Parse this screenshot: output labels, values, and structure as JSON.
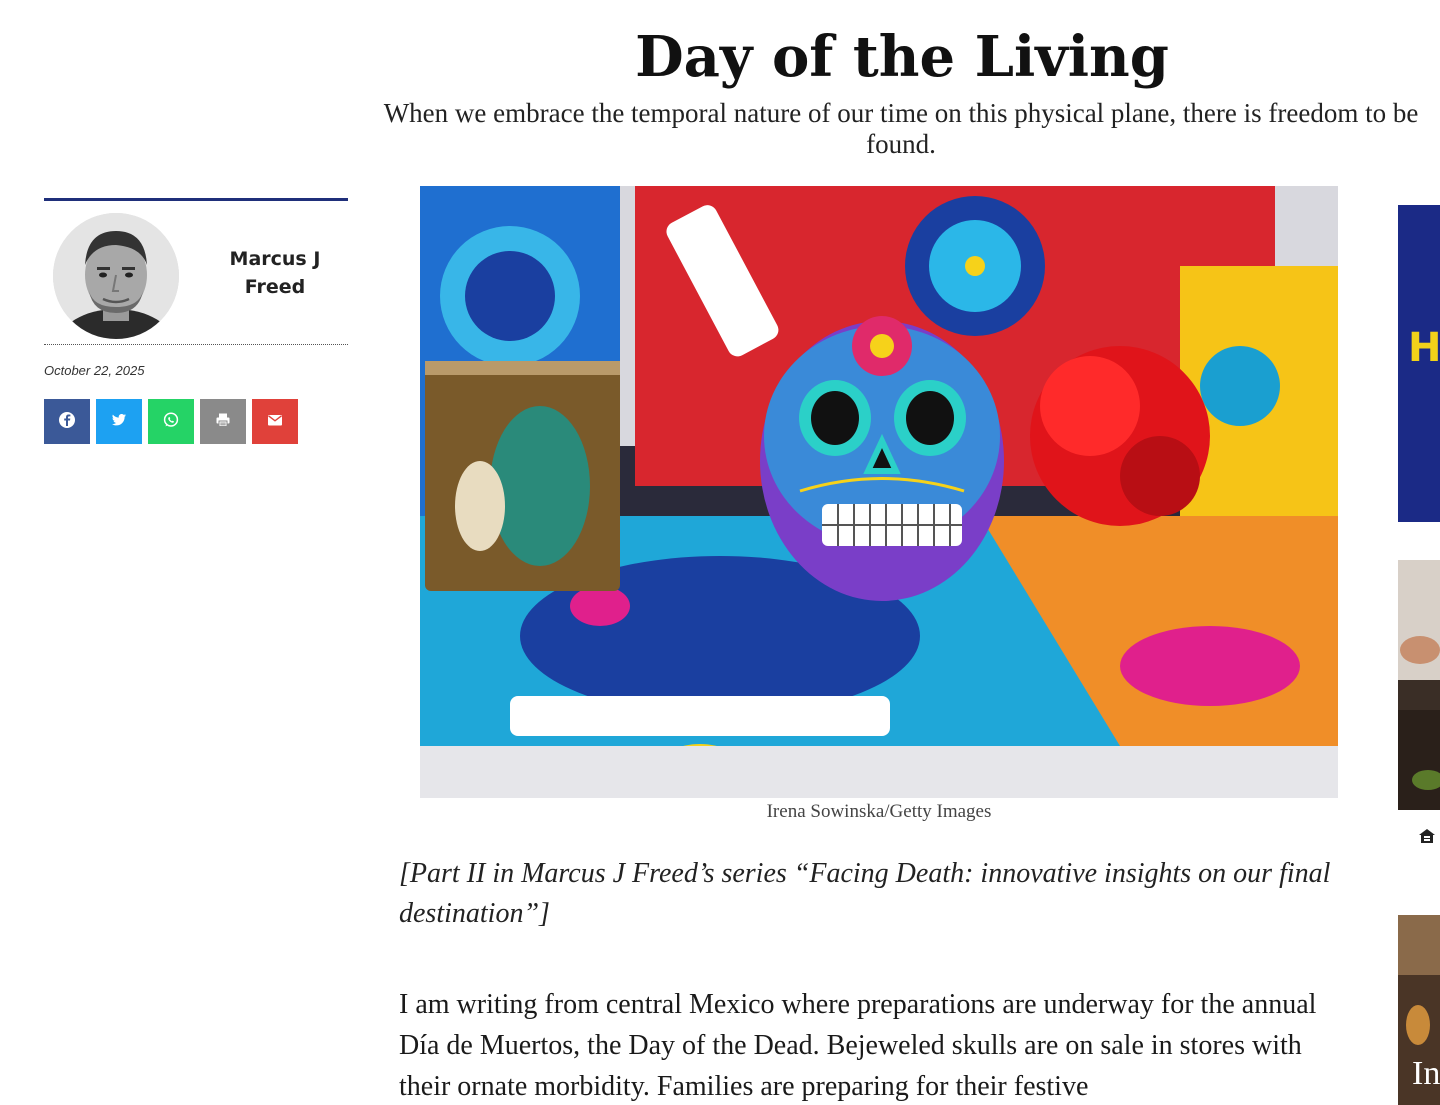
{
  "article": {
    "title": "Day of the Living",
    "subtitle": "When we embrace the temporal nature of our time on this physical plane, there is freedom to be found.",
    "image_caption": "Irena Sowinska/Getty Images",
    "series_note": "[Part II in Marcus J Freed’s series “Facing Death: innovative insights on our final destination”]",
    "body": "I am writing from central Mexico where preparations are underway for the annual Día de Muertos, the Day of the Dead. Bejeweled skulls are on sale in stores with their ornate morbidity. Families are preparing for their festive"
  },
  "author": {
    "name": "Marcus J Freed",
    "date": "October 22, 2025"
  },
  "share": [
    {
      "name": "facebook",
      "icon": "facebook-icon",
      "color": "#3b5998"
    },
    {
      "name": "twitter",
      "icon": "twitter-icon",
      "color": "#1da1f2"
    },
    {
      "name": "whatsapp",
      "icon": "whatsapp-icon",
      "color": "#25d366"
    },
    {
      "name": "print",
      "icon": "print-icon",
      "color": "#8a8a8a"
    },
    {
      "name": "email",
      "icon": "email-icon",
      "color": "#e0413a"
    }
  ],
  "ads": {
    "top_letter": "H",
    "bottom_letter": "In"
  },
  "colors": {
    "author_rule": "#1f2f7a"
  }
}
